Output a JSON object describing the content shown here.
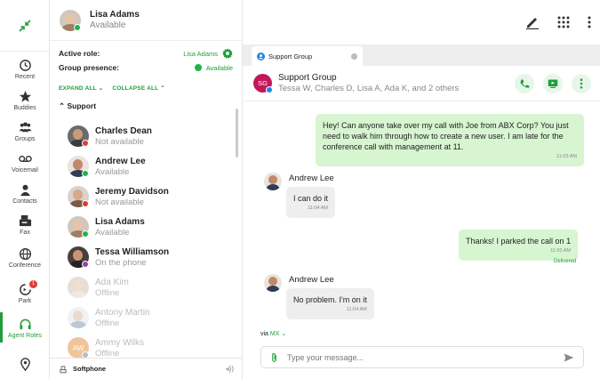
{
  "me": {
    "name": "Lisa Adams",
    "status": "Available"
  },
  "roles": {
    "active_role_label": "Active role:",
    "active_role_value": "Lisa Adams",
    "group_presence_label": "Group presence:",
    "group_presence_value": "Available"
  },
  "controls": {
    "expand_all": "EXPAND ALL",
    "collapse_all": "COLLAPSE ALL"
  },
  "group": {
    "name": "Support"
  },
  "contacts": [
    {
      "name": "Charles Dean",
      "status": "Not available"
    },
    {
      "name": "Andrew Lee",
      "status": "Available"
    },
    {
      "name": "Jeremy Davidson",
      "status": "Not available"
    },
    {
      "name": "Lisa Adams",
      "status": "Available"
    },
    {
      "name": "Tessa Williamson",
      "status": "On the phone"
    },
    {
      "name": "Ada Kim",
      "status": "Offline"
    },
    {
      "name": "Antony Martin",
      "status": "Offline"
    },
    {
      "name": "Ammy Wilks",
      "status": "Offline",
      "initials": "AW"
    }
  ],
  "rail": [
    {
      "label": "Recent",
      "icon": "clock-icon"
    },
    {
      "label": "Buddies",
      "icon": "star-icon"
    },
    {
      "label": "Groups",
      "icon": "groups-icon"
    },
    {
      "label": "Voicemail",
      "icon": "voicemail-icon"
    },
    {
      "label": "Contacts",
      "icon": "contacts-icon"
    },
    {
      "label": "Fax",
      "icon": "fax-icon"
    },
    {
      "label": "Conference",
      "icon": "globe-icon"
    },
    {
      "label": "Park",
      "icon": "park-icon",
      "badge": "1"
    },
    {
      "label": "Agent Roles",
      "icon": "headset-icon"
    }
  ],
  "softphone": {
    "label": "Softphone"
  },
  "tab": {
    "label": "Support Group"
  },
  "chat_header": {
    "avatar_initials": "SG",
    "title": "Support Group",
    "subtitle": "Tessa W, Charles D, Lisa A, Ada K, and 2 others"
  },
  "messages": [
    {
      "direction": "out",
      "text": "Hey! Can anyone take over my call with Joe from ABX Corp? You just need to walk him through how to create a new user. I am late for the conference call with management at 11.",
      "time": "11:03 AM"
    },
    {
      "direction": "in",
      "sender": "Andrew Lee",
      "text": "I can do it",
      "time": "11:04 AM"
    },
    {
      "direction": "out",
      "text": "Thanks! I parked the call on 1",
      "time": "11:03 AM",
      "receipt": "Delivered"
    },
    {
      "direction": "in",
      "sender": "Andrew Lee",
      "text": "No problem. I'm on it",
      "time": "11:04 AM"
    }
  ],
  "composer": {
    "via_label": "via",
    "via_value": "MX",
    "placeholder": "Type your message..."
  },
  "colors": {
    "accent": "#1f9e3a",
    "arc": "#e8642c",
    "out_bubble": "#d7f5d0",
    "in_bubble": "#eeeeee",
    "group_avatar": "#c2185b"
  }
}
